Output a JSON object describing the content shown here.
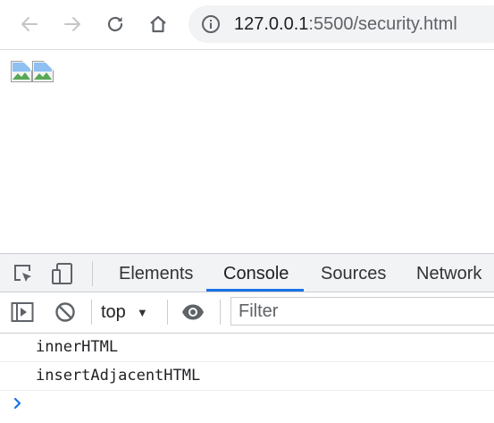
{
  "browser": {
    "url_host": "127.0.0.1",
    "url_rest": ":5500/security.html",
    "icons": [
      "back-arrow-icon",
      "forward-arrow-icon",
      "reload-icon",
      "home-icon",
      "info-icon"
    ],
    "colors": {
      "omnibox_bg": "#f1f3f4",
      "icon": "#5f6368",
      "icon_disabled": "#c4c7c5"
    }
  },
  "page": {
    "broken_images": [
      {
        "icon": "broken-image-icon"
      },
      {
        "icon": "broken-image-icon"
      }
    ]
  },
  "devtools": {
    "toolbar_icons": [
      "inspect-element-icon",
      "device-toolbar-icon"
    ],
    "tabs": [
      {
        "label": "Elements",
        "active": false
      },
      {
        "label": "Console",
        "active": true
      },
      {
        "label": "Sources",
        "active": false
      },
      {
        "label": "Network",
        "active": false
      }
    ],
    "console_toolbar": {
      "icons": [
        "sidebar-toggle-icon",
        "clear-console-icon",
        "eye-icon"
      ],
      "context": "top",
      "filter_placeholder": "Filter"
    },
    "logs": [
      {
        "text": "innerHTML"
      },
      {
        "text": "insertAdjacentHTML"
      }
    ],
    "prompt_icon": "chevron-right-icon",
    "colors": {
      "accent": "#1a73e8",
      "tabbar_bg": "#f1f3f4"
    }
  }
}
